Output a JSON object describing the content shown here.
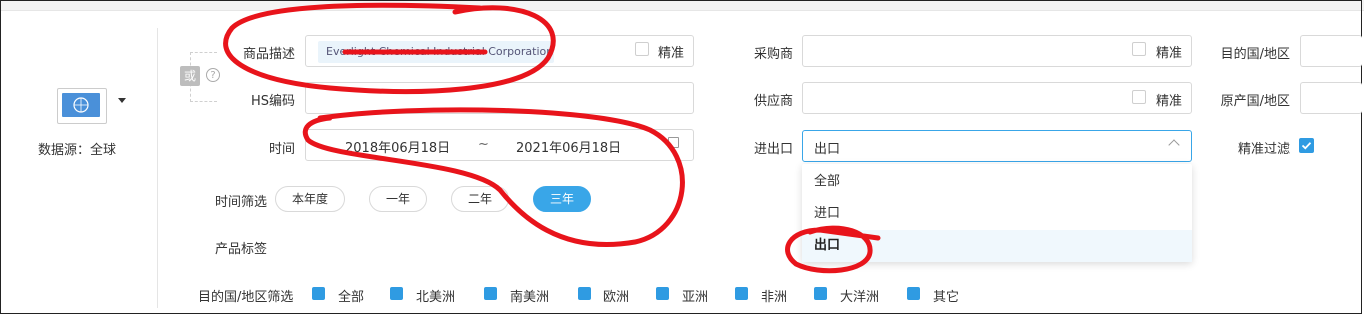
{
  "data_source": {
    "label": "数据源：全球",
    "flag_icon": "un-flag-icon"
  },
  "or_toggle": {
    "label": "或",
    "help_icon": "question-circle-icon"
  },
  "fields": {
    "product_desc": {
      "label": "商品描述",
      "tag_value": "Everlight Chemical Industrial Corporation",
      "exact_label": "精准"
    },
    "hs_code": {
      "label": "HS编码",
      "value": ""
    },
    "time": {
      "label": "时间",
      "start": "2018年06月18日",
      "separator": "~",
      "end": "2021年06月18日"
    },
    "buyer": {
      "label": "采购商",
      "exact_label": "精准"
    },
    "supplier": {
      "label": "供应商",
      "exact_label": "精准"
    },
    "import_export": {
      "label": "进出口",
      "value": "出口"
    },
    "dest_country": {
      "label": "目的国/地区"
    },
    "origin_country": {
      "label": "原产国/地区"
    },
    "exact_filter": {
      "label": "精准过滤",
      "checked": true
    }
  },
  "time_filter": {
    "label": "时间筛选",
    "options": [
      "本年度",
      "一年",
      "二年",
      "三年"
    ],
    "active": "三年"
  },
  "product_tag": {
    "label": "产品标签"
  },
  "dropdown": {
    "options": [
      "全部",
      "进口",
      "出口"
    ],
    "selected": "出口"
  },
  "dest_filter": {
    "label": "目的国/地区筛选",
    "options": [
      "全部",
      "北美洲",
      "南美洲",
      "欧洲",
      "亚洲",
      "非洲",
      "大洋洲",
      "其它"
    ]
  },
  "colors": {
    "accent": "#39a6e8",
    "checkbox_blue": "#2f9be2",
    "annotation_red": "#e8141b"
  }
}
